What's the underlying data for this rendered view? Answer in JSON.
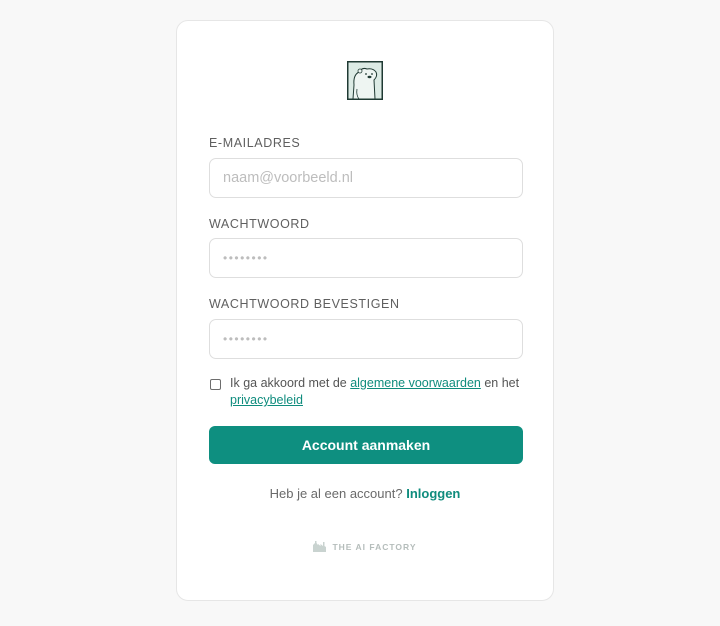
{
  "form": {
    "email_label": "E-MAILADRES",
    "email_placeholder": "naam@voorbeeld.nl",
    "email_value": "",
    "password_label": "WACHTWOORD",
    "password_placeholder": "••••••••",
    "password_value": "",
    "confirm_label": "WACHTWOORD BEVESTIGEN",
    "confirm_placeholder": "••••••••",
    "confirm_value": "",
    "terms_checked": false,
    "terms_prefix": "Ik ga akkoord met de ",
    "terms_link": "algemene voorwaarden",
    "terms_middle": " en het ",
    "privacy_link": "privacybeleid",
    "submit_label": "Account aanmaken"
  },
  "signin": {
    "prompt": "Heb je al een account?",
    "link": "Inloggen"
  },
  "footer": {
    "brand": "THE AI FACTORY"
  },
  "icons": {
    "logo": "polar-bear-logo",
    "footer": "factory-icon"
  },
  "colors": {
    "accent": "#0e8f80",
    "background": "#f8f8f8",
    "card": "#ffffff"
  }
}
